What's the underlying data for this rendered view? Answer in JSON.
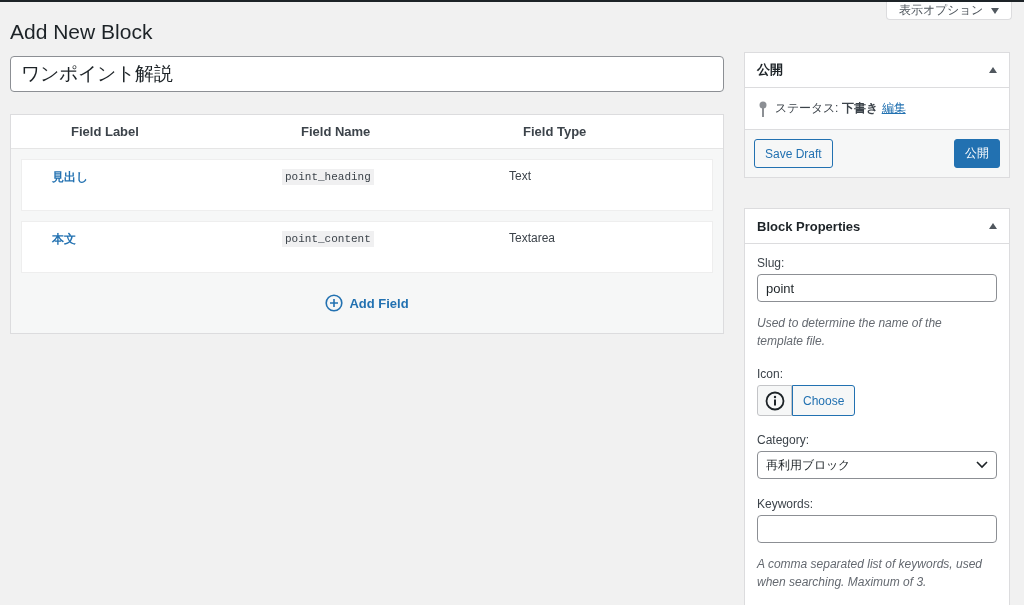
{
  "screen_options": {
    "label": "表示オプション",
    "expanded": false
  },
  "page_title": "Add New Block",
  "title_field": {
    "value": "ワンポイント解説"
  },
  "fields_table": {
    "columns": [
      "Field Label",
      "Field Name",
      "Field Type"
    ],
    "rows": [
      {
        "label": "見出し",
        "name": "point_heading",
        "type": "Text"
      },
      {
        "label": "本文",
        "name": "point_content",
        "type": "Textarea"
      }
    ],
    "add_button": "Add Field"
  },
  "publish_box": {
    "title": "公開",
    "expanded": true,
    "status": "ステータス: **下書き**",
    "edit_link": "編集",
    "save_draft": "Save Draft",
    "publish": "公開"
  },
  "properties_box": {
    "title": "Block Properties",
    "expanded": true,
    "slug": {
      "label": "Slug:",
      "value": "point",
      "help": "Used to determine the name of the template file."
    },
    "icon": {
      "label": "Icon:",
      "choose": "Choose"
    },
    "category": {
      "label": "Category:",
      "value": "再利用ブロック"
    },
    "keywords": {
      "label": "Keywords:",
      "help": "A comma separated list of keywords, used when searching. Maximum of 3."
    }
  }
}
